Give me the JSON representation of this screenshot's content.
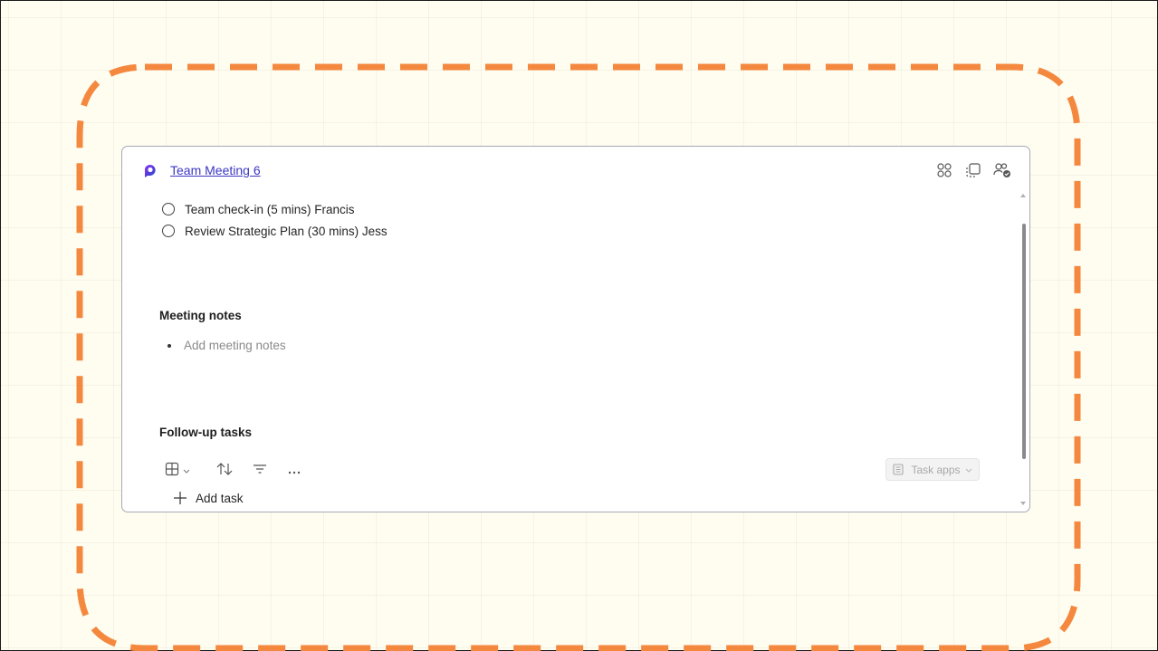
{
  "colors": {
    "background": "#fefdf0",
    "dashed_outline": "#f5883f",
    "link": "#3b37c4",
    "card_border": "#a9a9b3"
  },
  "card": {
    "title": "Team Meeting 6",
    "logo_icon": "loop-logo-icon",
    "header_icons": [
      "apps-grid-icon",
      "copy-component-icon",
      "people-check-icon"
    ]
  },
  "agenda": {
    "items": [
      {
        "label": "Team check-in (5 mins) Francis"
      },
      {
        "label": "Review Strategic Plan (30 mins) Jess"
      }
    ]
  },
  "meeting_notes": {
    "heading": "Meeting notes",
    "placeholder": "Add meeting notes"
  },
  "follow_up": {
    "heading": "Follow-up tasks",
    "toolbar_icons": [
      "table-view-icon",
      "sort-icon",
      "filter-icon",
      "more-icon"
    ],
    "task_apps_label": "Task apps",
    "add_task_label": "Add task"
  }
}
